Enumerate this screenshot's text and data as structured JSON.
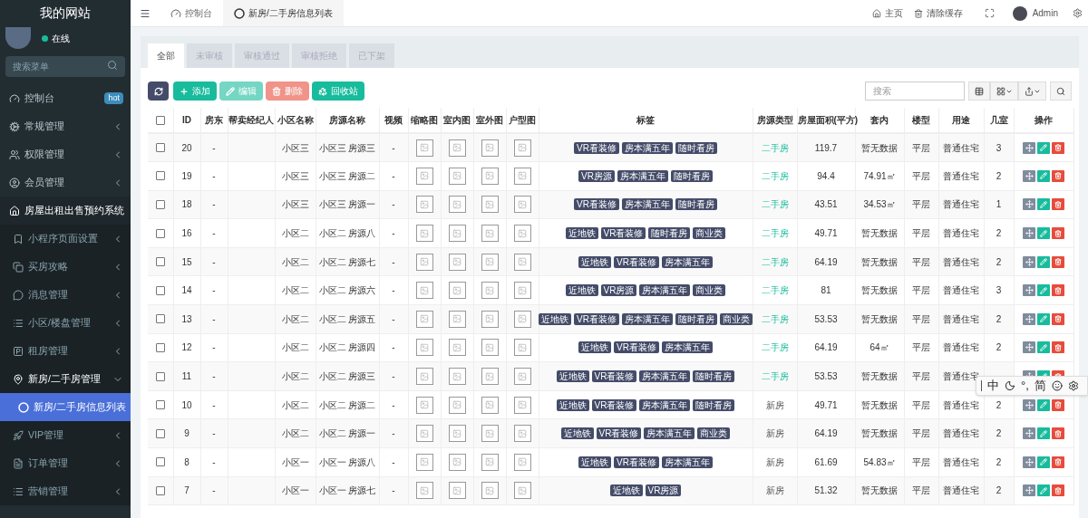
{
  "sidebar": {
    "title": "我的网站",
    "status": "在线",
    "search": {
      "placeholder": "搜索菜单"
    },
    "items": [
      {
        "label": "控制台",
        "badge": "hot",
        "expanded": false
      },
      {
        "label": "常规管理",
        "expanded": false
      },
      {
        "label": "权限管理",
        "expanded": false
      },
      {
        "label": "会员管理",
        "expanded": false
      },
      {
        "label": "房屋出租出售预约系统",
        "expanded": true,
        "children": [
          {
            "label": "小程序页面设置",
            "expanded": false
          },
          {
            "label": "买房攻略",
            "expanded": false
          },
          {
            "label": "消息管理",
            "expanded": false
          },
          {
            "label": "小区/楼盘管理",
            "expanded": false
          },
          {
            "label": "租房管理",
            "expanded": false
          },
          {
            "label": "新房/二手房管理",
            "expanded": true,
            "children": [
              {
                "label": "新房/二手房信息列表",
                "selected": true
              }
            ]
          },
          {
            "label": "VIP管理",
            "expanded": false
          },
          {
            "label": "订单管理",
            "expanded": false
          },
          {
            "label": "营销管理",
            "expanded": false
          }
        ]
      }
    ]
  },
  "topbar": {
    "tabs": [
      {
        "label": "控制台",
        "selected": false
      },
      {
        "label": "新房/二手房信息列表",
        "selected": true
      }
    ],
    "links": [
      "主页",
      "清除缓存"
    ],
    "user": "Admin"
  },
  "filter_tabs": [
    {
      "label": "全部",
      "selected": true
    },
    {
      "label": "未审核",
      "selected": false
    },
    {
      "label": "审核通过",
      "selected": false
    },
    {
      "label": "审核拒绝",
      "selected": false
    },
    {
      "label": "已下架",
      "selected": false
    }
  ],
  "toolbar": {
    "buttons": [
      {
        "label": "添加",
        "kind": "add",
        "disabled": false
      },
      {
        "label": "编辑",
        "kind": "edit",
        "disabled": true
      },
      {
        "label": "删除",
        "kind": "delete",
        "disabled": true
      },
      {
        "label": "回收站",
        "kind": "recycle",
        "disabled": false
      }
    ],
    "search": {
      "placeholder": "搜索"
    }
  },
  "table": {
    "all_checked": false,
    "columns": [
      "ID",
      "房东",
      "帮卖经纪人",
      "小区名称",
      "房源名称",
      "视频",
      "缩略图",
      "室内图",
      "室外图",
      "户型图",
      "标签",
      "房源类型",
      "房屋面积(平方)",
      "套内",
      "楼型",
      "用途",
      "几室",
      "操作"
    ],
    "rows": [
      {
        "checked": false,
        "id": "20",
        "owner": "-",
        "community": "小区三",
        "name": "小区三 房源三",
        "video": "-",
        "tags": [
          "VR看装修",
          "房本满五年",
          "随时看房"
        ],
        "type": "二手房",
        "type_highlighted": true,
        "area": "119.7",
        "inner": "暂无数据",
        "floor": "平层",
        "usage": "普通住宅",
        "rooms": "3"
      },
      {
        "checked": false,
        "id": "19",
        "owner": "-",
        "community": "小区三",
        "name": "小区三 房源二",
        "video": "-",
        "tags": [
          "VR房源",
          "房本满五年",
          "随时看房"
        ],
        "type": "二手房",
        "type_highlighted": true,
        "area": "94.4",
        "inner": "74.91㎡",
        "floor": "平层",
        "usage": "普通住宅",
        "rooms": "2"
      },
      {
        "checked": false,
        "id": "18",
        "owner": "-",
        "community": "小区三",
        "name": "小区三 房源一",
        "video": "-",
        "tags": [
          "VR看装修",
          "房本满五年",
          "随时看房"
        ],
        "type": "二手房",
        "type_highlighted": true,
        "area": "43.51",
        "inner": "34.53㎡",
        "floor": "平层",
        "usage": "普通住宅",
        "rooms": "1"
      },
      {
        "checked": false,
        "id": "16",
        "owner": "-",
        "community": "小区二",
        "name": "小区二 房源八",
        "video": "-",
        "tags": [
          "近地铁",
          "VR看装修",
          "随时看房",
          "商业类"
        ],
        "type": "二手房",
        "type_highlighted": true,
        "area": "49.71",
        "inner": "暂无数据",
        "floor": "平层",
        "usage": "普通住宅",
        "rooms": "2"
      },
      {
        "checked": false,
        "id": "15",
        "owner": "-",
        "community": "小区二",
        "name": "小区二 房源七",
        "video": "-",
        "tags": [
          "近地铁",
          "VR看装修",
          "房本满五年"
        ],
        "type": "二手房",
        "type_highlighted": true,
        "area": "64.19",
        "inner": "暂无数据",
        "floor": "平层",
        "usage": "普通住宅",
        "rooms": "2"
      },
      {
        "checked": false,
        "id": "14",
        "owner": "-",
        "community": "小区二",
        "name": "小区二 房源六",
        "video": "-",
        "tags": [
          "近地铁",
          "VR房源",
          "房本满五年",
          "商业类"
        ],
        "type": "二手房",
        "type_highlighted": true,
        "area": "81",
        "inner": "暂无数据",
        "floor": "平层",
        "usage": "普通住宅",
        "rooms": "3"
      },
      {
        "checked": false,
        "id": "13",
        "owner": "-",
        "community": "小区二",
        "name": "小区二 房源五",
        "video": "-",
        "tags": [
          "近地铁",
          "VR看装修",
          "房本满五年",
          "随时看房",
          "商业类"
        ],
        "type": "二手房",
        "type_highlighted": true,
        "area": "53.53",
        "inner": "暂无数据",
        "floor": "平层",
        "usage": "普通住宅",
        "rooms": "2"
      },
      {
        "checked": false,
        "id": "12",
        "owner": "-",
        "community": "小区二",
        "name": "小区二 房源四",
        "video": "-",
        "tags": [
          "近地铁",
          "VR看装修",
          "房本满五年"
        ],
        "type": "二手房",
        "type_highlighted": true,
        "area": "64.19",
        "inner": "64㎡",
        "floor": "平层",
        "usage": "普通住宅",
        "rooms": "2"
      },
      {
        "checked": false,
        "id": "11",
        "owner": "-",
        "community": "小区二",
        "name": "小区二 房源三",
        "video": "-",
        "tags": [
          "近地铁",
          "VR看装修",
          "房本满五年",
          "随时看房"
        ],
        "type": "二手房",
        "type_highlighted": true,
        "area": "53.53",
        "inner": "暂无数据",
        "floor": "平层",
        "usage": "普通住宅"
      },
      {
        "checked": false,
        "id": "10",
        "owner": "-",
        "community": "小区二",
        "name": "小区二 房源二",
        "video": "-",
        "tags": [
          "近地铁",
          "VR看装修",
          "房本满五年",
          "随时看房"
        ],
        "type": "新房",
        "type_highlighted": false,
        "area": "49.71",
        "inner": "暂无数据",
        "floor": "平层",
        "usage": "普通住宅",
        "rooms": "2"
      },
      {
        "checked": false,
        "id": "9",
        "owner": "-",
        "community": "小区二",
        "name": "小区二 房源一",
        "video": "-",
        "tags": [
          "近地铁",
          "VR看装修",
          "房本满五年",
          "商业类"
        ],
        "type": "新房",
        "type_highlighted": false,
        "area": "64.19",
        "inner": "暂无数据",
        "floor": "平层",
        "usage": "普通住宅",
        "rooms": "2"
      },
      {
        "checked": false,
        "id": "8",
        "owner": "-",
        "community": "小区一",
        "name": "小区一 房源八",
        "video": "-",
        "tags": [
          "近地铁",
          "VR看装修",
          "房本满五年"
        ],
        "type": "新房",
        "type_highlighted": false,
        "area": "61.69",
        "inner": "54.83㎡",
        "floor": "平层",
        "usage": "普通住宅",
        "rooms": "2"
      },
      {
        "checked": false,
        "id": "7",
        "owner": "-",
        "community": "小区一",
        "name": "小区一 房源七",
        "video": "-",
        "tags": [
          "近地铁",
          "VR房源"
        ],
        "type": "新房",
        "type_highlighted": false,
        "area": "51.32",
        "inner": "暂无数据",
        "floor": "平层",
        "usage": "普通住宅",
        "rooms": "2"
      }
    ]
  },
  "ime_toolbar": {
    "mode": "中",
    "punctuation": "°,",
    "script": "简"
  }
}
